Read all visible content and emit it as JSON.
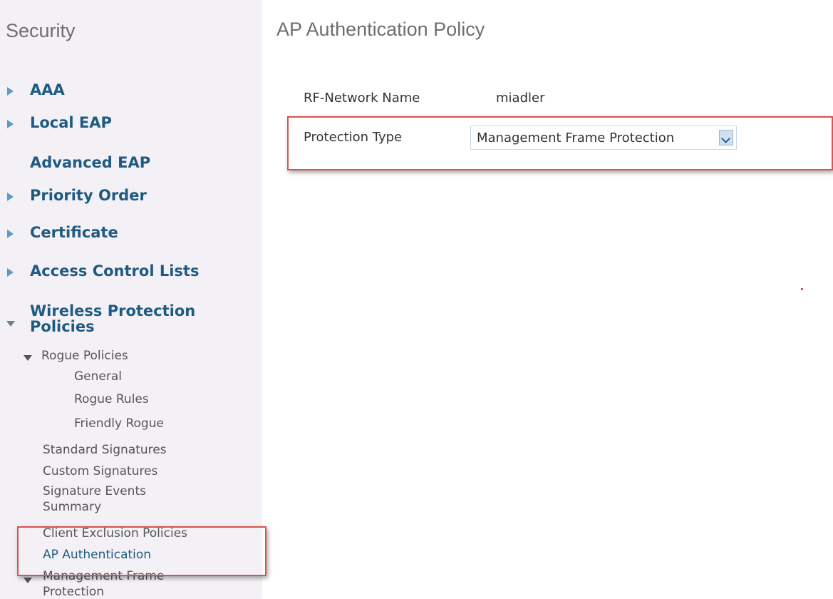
{
  "sidebar": {
    "title": "Security",
    "items": [
      {
        "label": "AAA"
      },
      {
        "label": "Local EAP"
      },
      {
        "label": "Advanced EAP"
      },
      {
        "label": "Priority Order"
      },
      {
        "label": "Certificate"
      },
      {
        "label": "Access Control Lists"
      },
      {
        "label_line1": "Wireless Protection",
        "label_line2": "Policies"
      }
    ],
    "sub": {
      "rogue_policies": "Rogue Policies",
      "general": "General",
      "rogue_rules": "Rogue Rules",
      "friendly_rogue": "Friendly Rogue",
      "standard_signatures": "Standard Signatures",
      "custom_signatures": "Custom Signatures",
      "signature_events_line1": "Signature Events",
      "signature_events_line2": "Summary",
      "client_exclusion": "Client Exclusion Policies",
      "ap_authentication": "AP Authentication",
      "management_frame_line1": "Management Frame",
      "management_frame_line2": "Protection"
    }
  },
  "main": {
    "title": "AP Authentication Policy",
    "rf_network_label": "RF-Network Name",
    "rf_network_value": "miadler",
    "protection_type_label": "Protection Type",
    "protection_type_value": "Management Frame Protection"
  },
  "colors": {
    "highlight": "#d9534f",
    "link": "#1f5a82",
    "sidebar_bg": "#f4f1f6"
  }
}
